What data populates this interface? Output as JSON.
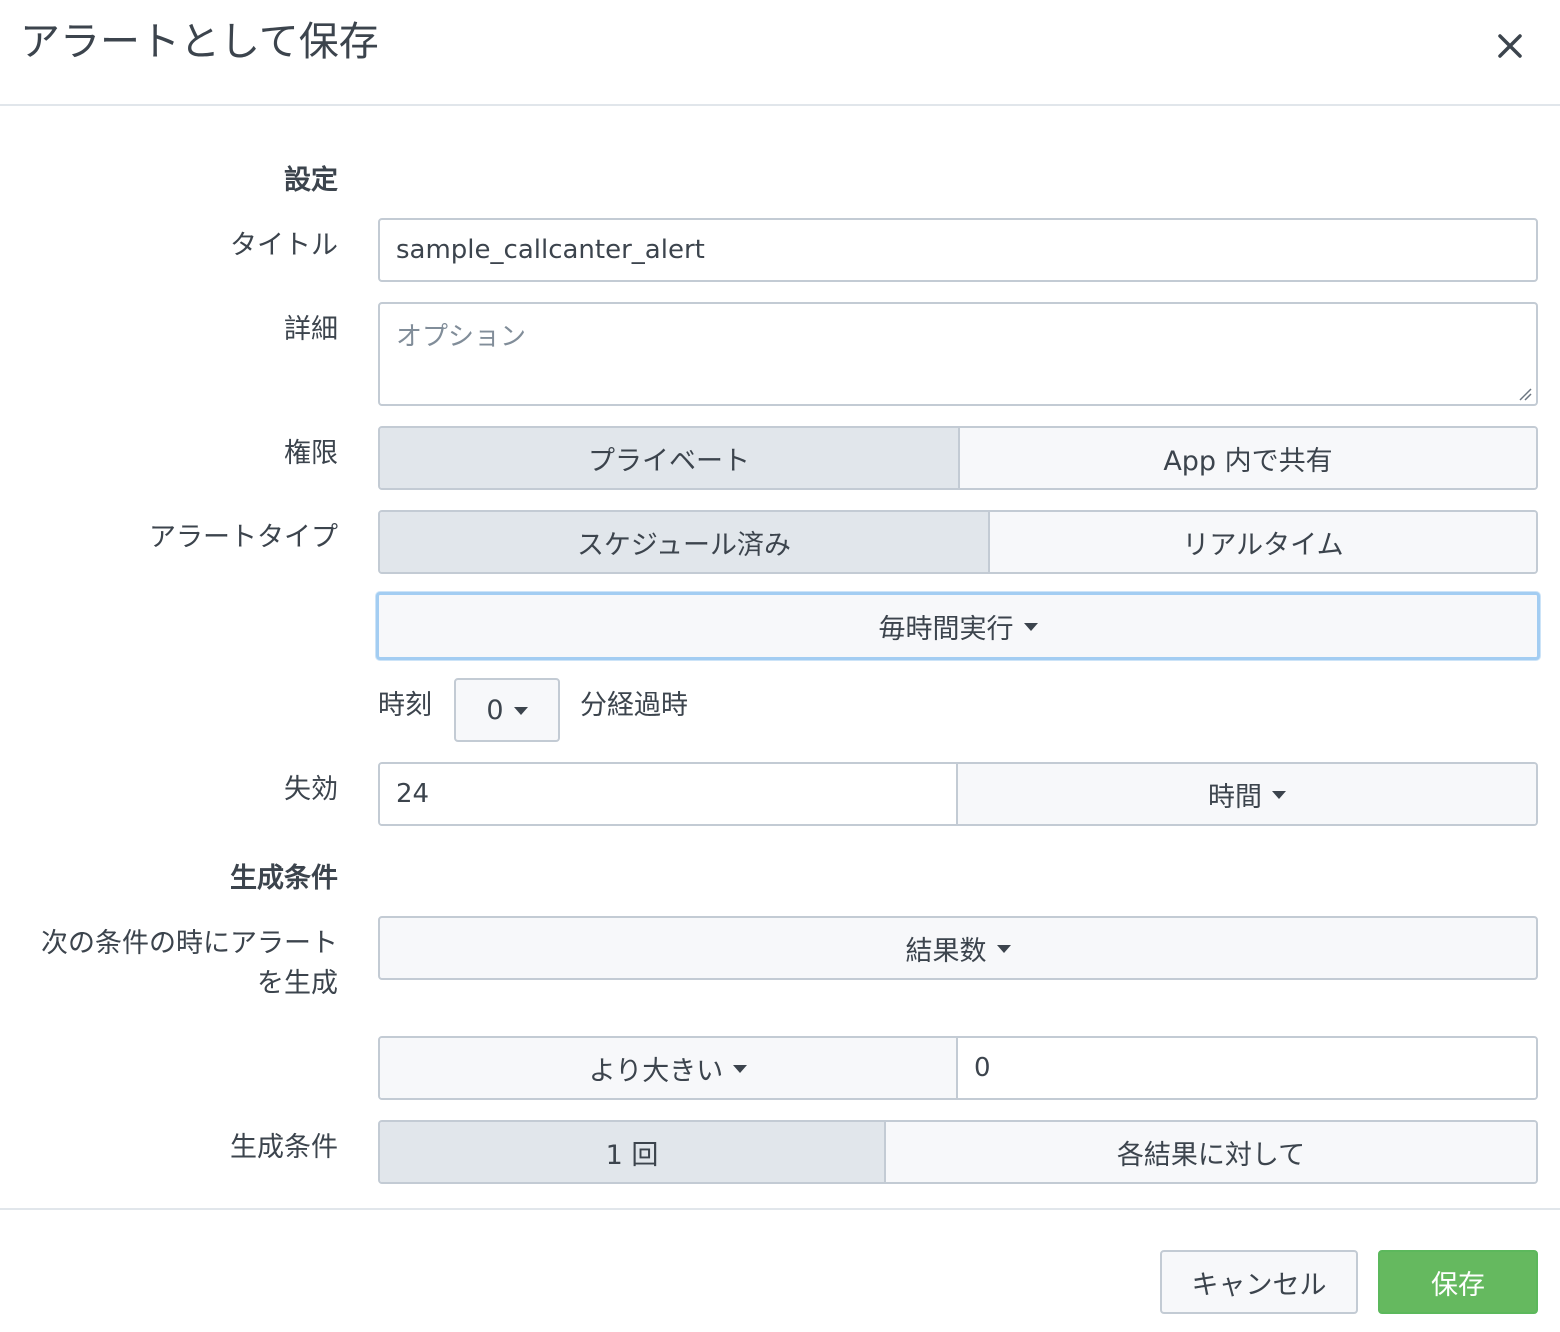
{
  "dialog": {
    "title": "アラートとして保存",
    "close_icon": "close-icon"
  },
  "settings": {
    "heading": "設定",
    "title_label": "タイトル",
    "title_value": "sample_callcanter_alert",
    "description_label": "詳細",
    "description_placeholder": "オプション",
    "permissions_label": "権限",
    "permissions_options": [
      "プライベート",
      "App 内で共有"
    ],
    "permissions_selected": "プライベート",
    "alert_type_label": "アラートタイプ",
    "alert_type_options": [
      "スケジュール済み",
      "リアルタイム"
    ],
    "alert_type_selected": "スケジュール済み",
    "schedule_value": "毎時間実行",
    "time_label": "時刻",
    "minute_value": "0",
    "minute_suffix": "分経過時",
    "expires_label": "失効",
    "expires_value": "24",
    "expires_unit": "時間"
  },
  "trigger": {
    "heading": "生成条件",
    "condition_label_line1": "次の条件の時にアラート",
    "condition_label_line2": "を生成",
    "condition_value": "結果数",
    "comparator_value": "より大きい",
    "threshold_value": "0",
    "trigger_label": "生成条件",
    "trigger_options": [
      "1 回",
      "各結果に対して"
    ],
    "trigger_selected": "1 回"
  },
  "footer": {
    "cancel_label": "キャンセル",
    "save_label": "保存"
  },
  "colors": {
    "save_button": "#65b95f",
    "focus_ring": "#a3cdf2",
    "active_segment": "#e1e6eb"
  }
}
